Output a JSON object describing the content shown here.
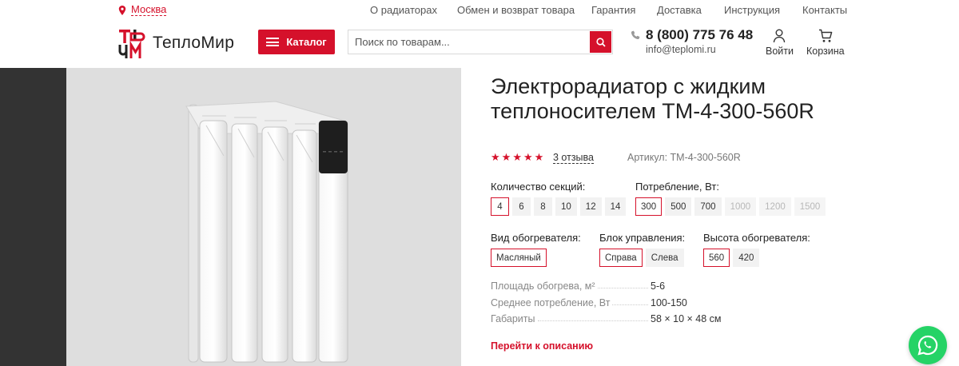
{
  "header": {
    "city": "Москва",
    "nav": [
      "О радиаторах",
      "Обмен и возврат товара",
      "Гарантия",
      "Доставка",
      "Инструкция",
      "Контакты"
    ],
    "brand": "ТеплоМир",
    "catalog_label": "Каталог",
    "search_placeholder": "Поиск по товарам...",
    "phone": "8 (800) 775 76 48",
    "email": "info@teplomi.ru",
    "login_label": "Войти",
    "cart_label": "Корзина"
  },
  "product": {
    "title": "Электрорадиатор с жидким теплоносителем ТМ-4-300-560R",
    "rating": 5,
    "reviews": "3 отзыва",
    "article": "Артикул: ТМ-4-300-560R",
    "sections_label": "Количество секций:",
    "sections": [
      "4",
      "6",
      "8",
      "10",
      "12",
      "14"
    ],
    "sections_selected": "4",
    "power_label": "Потребление, Вт:",
    "power": [
      "300",
      "500",
      "700",
      "1000",
      "1200",
      "1500"
    ],
    "power_selected": "300",
    "power_disabled": [
      "1000",
      "1200",
      "1500"
    ],
    "heater_type_label": "Вид обогревателя:",
    "heater_type": [
      "Масляный"
    ],
    "control_label": "Блок управления:",
    "control": [
      "Справа",
      "Слева"
    ],
    "control_selected": "Справа",
    "height_label": "Высота обогревателя:",
    "height": [
      "560",
      "420"
    ],
    "height_selected": "560",
    "specs": [
      {
        "k": "Площадь обогрева, м²",
        "v": "5-6"
      },
      {
        "k": "Среднее потребление, Вт",
        "v": "100-150"
      },
      {
        "k": "Габариты",
        "v": "58 × 10 × 48 см"
      }
    ],
    "description_link": "Перейти к описанию"
  },
  "colors": {
    "accent": "#d5112b",
    "whatsapp": "#25d366",
    "dark": "#333333"
  },
  "icons": [
    "location-pin-icon",
    "menu-icon",
    "search-icon",
    "phone-icon",
    "user-icon",
    "cart-icon",
    "whatsapp-icon",
    "star-icon"
  ]
}
